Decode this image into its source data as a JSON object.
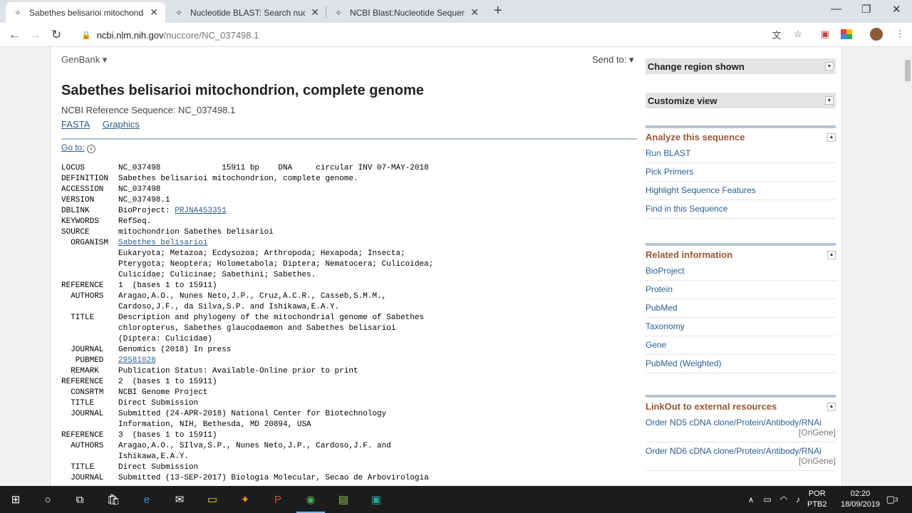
{
  "tabs": [
    {
      "title": "Sabethes belisarioi mitochondrio",
      "active": true
    },
    {
      "title": "Nucleotide BLAST: Search nucleo",
      "active": false
    },
    {
      "title": "NCBI Blast:Nucleotide Sequence",
      "active": false
    }
  ],
  "address": {
    "host": "ncbi.nlm.nih.gov",
    "path": "/nuccore/NC_037498.1"
  },
  "page": {
    "format_menu": "GenBank ▾",
    "send_to": "Send to: ▾",
    "title": "Sabethes belisarioi mitochondrion, complete genome",
    "subtitle": "NCBI Reference Sequence: NC_037498.1",
    "fasta": "FASTA",
    "graphics": "Graphics",
    "goto": "Go to:"
  },
  "genbank_rows": [
    {
      "k": "LOCUS",
      "v": "NC_037498             15911 bp    DNA     circular INV 07-MAY-2018"
    },
    {
      "k": "DEFINITION",
      "v": "Sabethes belisarioi mitochondrion, complete genome."
    },
    {
      "k": "ACCESSION",
      "v": "NC_037498"
    },
    {
      "k": "VERSION",
      "v": "NC_037498.1"
    },
    {
      "k": "DBLINK",
      "v": "BioProject: ",
      "link": "PRJNA453351"
    },
    {
      "k": "KEYWORDS",
      "v": "RefSeq."
    },
    {
      "k": "SOURCE",
      "v": "mitochondrion Sabethes belisarioi"
    },
    {
      "k": "  ORGANISM",
      "v": "",
      "link": "Sabethes belisarioi"
    },
    {
      "k": "",
      "v": "Eukaryota; Metazoa; Ecdysozoa; Arthropoda; Hexapoda; Insecta;"
    },
    {
      "k": "",
      "v": "Pterygota; Neoptera; Holometabola; Diptera; Nematocera; Culicoidea;"
    },
    {
      "k": "",
      "v": "Culicidae; Culicinae; Sabethini; Sabethes."
    },
    {
      "k": "REFERENCE",
      "v": "1  (bases 1 to 15911)"
    },
    {
      "k": "  AUTHORS",
      "v": "Aragao,A.O., Nunes Neto,J.P., Cruz,A.C.R., Casseb,S.M.M.,"
    },
    {
      "k": "",
      "v": "Cardoso,J.F., da Silva,S.P. and Ishikawa,E.A.Y."
    },
    {
      "k": "  TITLE",
      "v": "Description and phylogeny of the mitochondrial genome of Sabethes"
    },
    {
      "k": "",
      "v": "chloropterus, Sabethes glaucodaemon and Sabethes belisarioi"
    },
    {
      "k": "",
      "v": "(Diptera: Culicidae)"
    },
    {
      "k": "  JOURNAL",
      "v": "Genomics (2018) In press"
    },
    {
      "k": "   PUBMED",
      "v": "",
      "link": "29581026"
    },
    {
      "k": "  REMARK",
      "v": "Publication Status: Available-Online prior to print"
    },
    {
      "k": "REFERENCE",
      "v": "2  (bases 1 to 15911)"
    },
    {
      "k": "  CONSRTM",
      "v": "NCBI Genome Project"
    },
    {
      "k": "  TITLE",
      "v": "Direct Submission"
    },
    {
      "k": "  JOURNAL",
      "v": "Submitted (24-APR-2018) National Center for Biotechnology"
    },
    {
      "k": "",
      "v": "Information, NIH, Bethesda, MD 20894, USA"
    },
    {
      "k": "REFERENCE",
      "v": "3  (bases 1 to 15911)"
    },
    {
      "k": "  AUTHORS",
      "v": "Aragao,A.O., SIlva,S.P., Nunes Neto,J.P., Cardoso,J.F. and"
    },
    {
      "k": "",
      "v": "Ishikawa,E.A.Y."
    },
    {
      "k": "  TITLE",
      "v": "Direct Submission"
    },
    {
      "k": "  JOURNAL",
      "v": "Submitted (13-SEP-2017) Biologia Molecular, Secao de Arbovirologia"
    }
  ],
  "sidebar": {
    "change_region": "Change region shown",
    "customize_view": "Customize view",
    "analyze": {
      "title": "Analyze this sequence",
      "items": [
        "Run BLAST",
        "Pick Primers",
        "Highlight Sequence Features",
        "Find in this Sequence"
      ]
    },
    "related": {
      "title": "Related information",
      "items": [
        "BioProject",
        "Protein",
        "PubMed",
        "Taxonomy",
        "Gene",
        "PubMed (Weighted)"
      ]
    },
    "linkout": {
      "title": "LinkOut to external resources",
      "items": [
        {
          "label": "Order ND5 cDNA clone/Protein/Antibody/RNAi",
          "src": "[OriGene]"
        },
        {
          "label": "Order ND6 cDNA clone/Protein/Antibody/RNAi",
          "src": "[OriGene]"
        }
      ]
    }
  },
  "taskbar": {
    "lang1": "POR",
    "lang2": "PTB2",
    "time": "02:20",
    "date": "18/09/2019",
    "notif": "3"
  }
}
